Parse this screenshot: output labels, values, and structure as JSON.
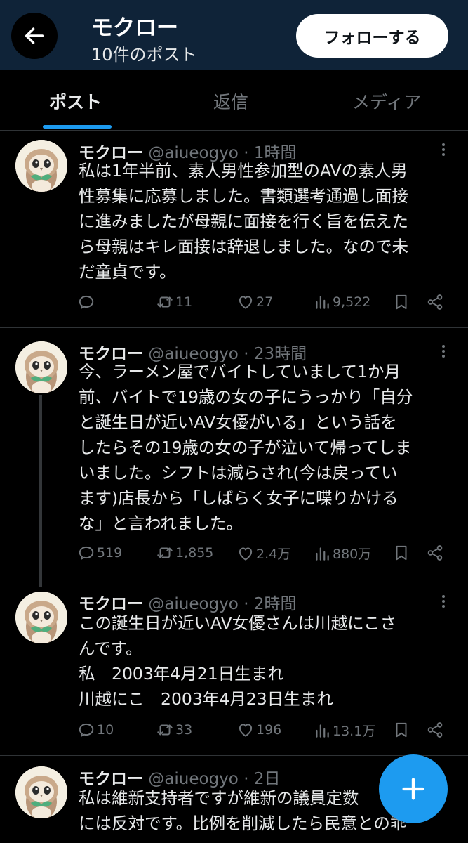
{
  "header": {
    "name": "モクロー",
    "post_count": "10件のポスト",
    "follow_label": "フォローする"
  },
  "tabs": [
    {
      "label": "ポスト",
      "active": true
    },
    {
      "label": "返信",
      "active": false
    },
    {
      "label": "メディア",
      "active": false
    }
  ],
  "posts": [
    {
      "name": "モクロー",
      "handle": "@aiueogyo",
      "time": "1時間",
      "lines": [
        "私は1年半前、素人男性参加型のAVの素人男",
        "性募集に応募しました。書類選考通過し面接",
        "に進みましたが母親に面接を行く旨を伝えた",
        "ら母親はキレ面接は辞退しました。なので未",
        "だ童貞です。"
      ],
      "replies": "",
      "reposts": "11",
      "likes": "27",
      "views": "9,522"
    },
    {
      "name": "モクロー",
      "handle": "@aiueogyo",
      "time": "23時間",
      "lines": [
        "今、ラーメン屋でバイトしていまして1か月",
        "前、バイトで19歳の女の子にうっかり「自分",
        "と誕生日が近いAV女優がいる」という話を",
        "したらその19歳の女の子が泣いて帰ってしま",
        "いました。シフトは減らされ(今は戻ってい",
        "ます)店長から「しばらく女子に喋りかける",
        "な」と言われました。"
      ],
      "replies": "519",
      "reposts": "1,855",
      "likes": "2.4万",
      "views": "880万"
    },
    {
      "name": "モクロー",
      "handle": "@aiueogyo",
      "time": "2時間",
      "lines": [
        "この誕生日が近いAV女優さんは川越にこさ",
        "んです。",
        "私　2003年4月21日生まれ",
        "川越にこ　2003年4月23日生まれ"
      ],
      "replies": "10",
      "reposts": "33",
      "likes": "196",
      "views": "13.1万"
    },
    {
      "name": "モクロー",
      "handle": "@aiueogyo",
      "time": "2日",
      "lines": [
        "私は維新支持者ですが維新の議員定数",
        "には反対です。比例を削減したら民意との乖"
      ]
    }
  ],
  "icons": {
    "back": "arrow-left-icon",
    "reply": "speech-bubble-icon",
    "repost": "repost-arrows-icon",
    "like": "heart-icon",
    "views": "bar-chart-icon",
    "bookmark": "bookmark-icon",
    "share": "share-icon",
    "more": "more-vertical-icon",
    "compose": "plus-icon"
  },
  "colors": {
    "header_bg": "#0f2338",
    "accent": "#1d9bf0",
    "muted": "#71767b",
    "text": "#e7e9ea"
  }
}
